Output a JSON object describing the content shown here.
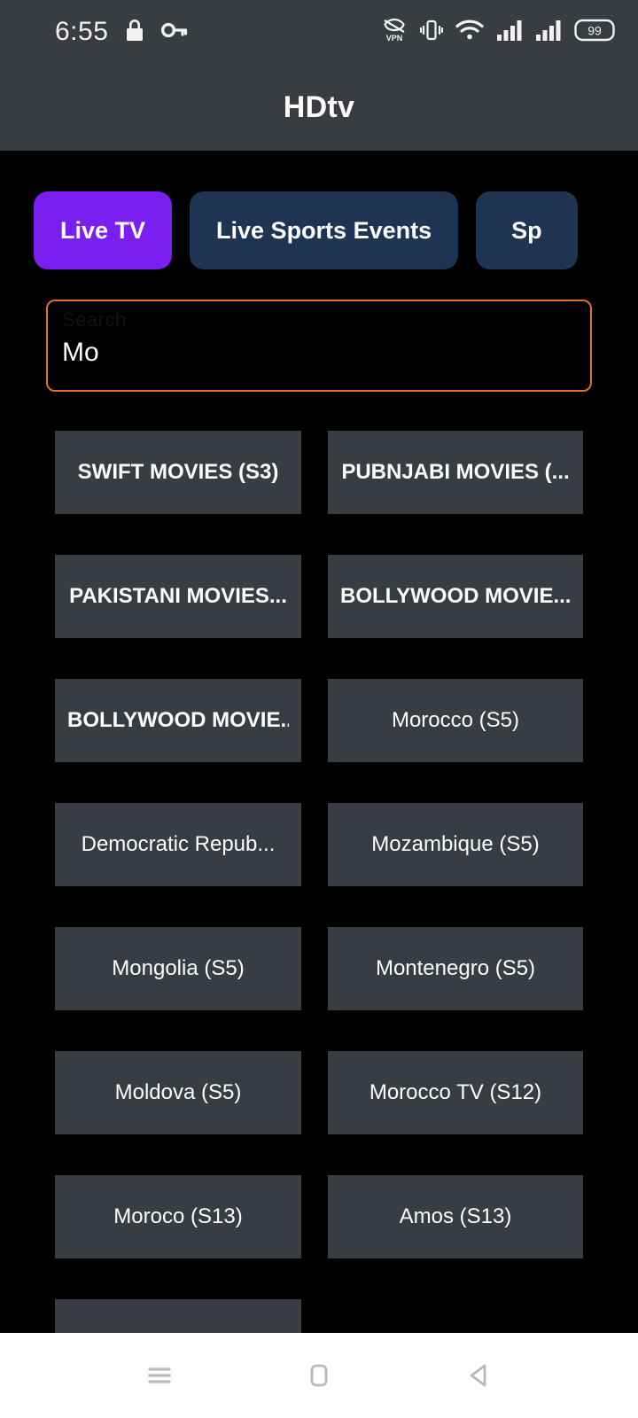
{
  "status_bar": {
    "time": "6:55",
    "battery_level": "99",
    "icons": {
      "lock": "lock-icon",
      "key": "key-icon",
      "vpn": "vpn-icon",
      "vibrate": "vibrate-icon",
      "wifi": "wifi-icon",
      "signal_1": "signal-bars-icon",
      "signal_2": "signal-bars-icon",
      "battery": "battery-icon"
    },
    "background": "#393c41"
  },
  "app_bar": {
    "title": "HDtv",
    "background": "#393c41"
  },
  "tabs": {
    "active_index": 0,
    "active_color": "#7b1ff0",
    "inactive_color": "#1f3352",
    "items": [
      {
        "label": "Live TV",
        "active": true
      },
      {
        "label": "Live Sports Events",
        "active": false
      },
      {
        "label": "Sp",
        "active": false,
        "truncated": true
      }
    ]
  },
  "search": {
    "value": "Mo",
    "placeholder": "Search",
    "border_color": "#e0702c"
  },
  "grid": {
    "cell_background": "#383c43",
    "items": [
      {
        "label": "SWIFT MOVIES (S3)",
        "caps": true
      },
      {
        "label": "PUBNJABI MOVIES (...",
        "caps": true
      },
      {
        "label": "PAKISTANI MOVIES...",
        "caps": true
      },
      {
        "label": "BOLLYWOOD MOVIE...",
        "caps": true
      },
      {
        "label": "BOLLYWOOD MOVIE...",
        "caps": true
      },
      {
        "label": "Morocco (S5)",
        "caps": false
      },
      {
        "label": "Democratic Repub...",
        "caps": false
      },
      {
        "label": "Mozambique (S5)",
        "caps": false
      },
      {
        "label": "Mongolia (S5)",
        "caps": false
      },
      {
        "label": "Montenegro (S5)",
        "caps": false
      },
      {
        "label": "Moldova (S5)",
        "caps": false
      },
      {
        "label": "Morocco TV (S12)",
        "caps": false
      },
      {
        "label": "Moroco (S13)",
        "caps": false
      },
      {
        "label": "Amos (S13)",
        "caps": false
      },
      {
        "label": "",
        "caps": false
      }
    ]
  },
  "nav_bar": {
    "background": "#ffffff",
    "buttons": [
      {
        "name": "recents-icon"
      },
      {
        "name": "home-icon"
      },
      {
        "name": "back-icon"
      }
    ]
  }
}
